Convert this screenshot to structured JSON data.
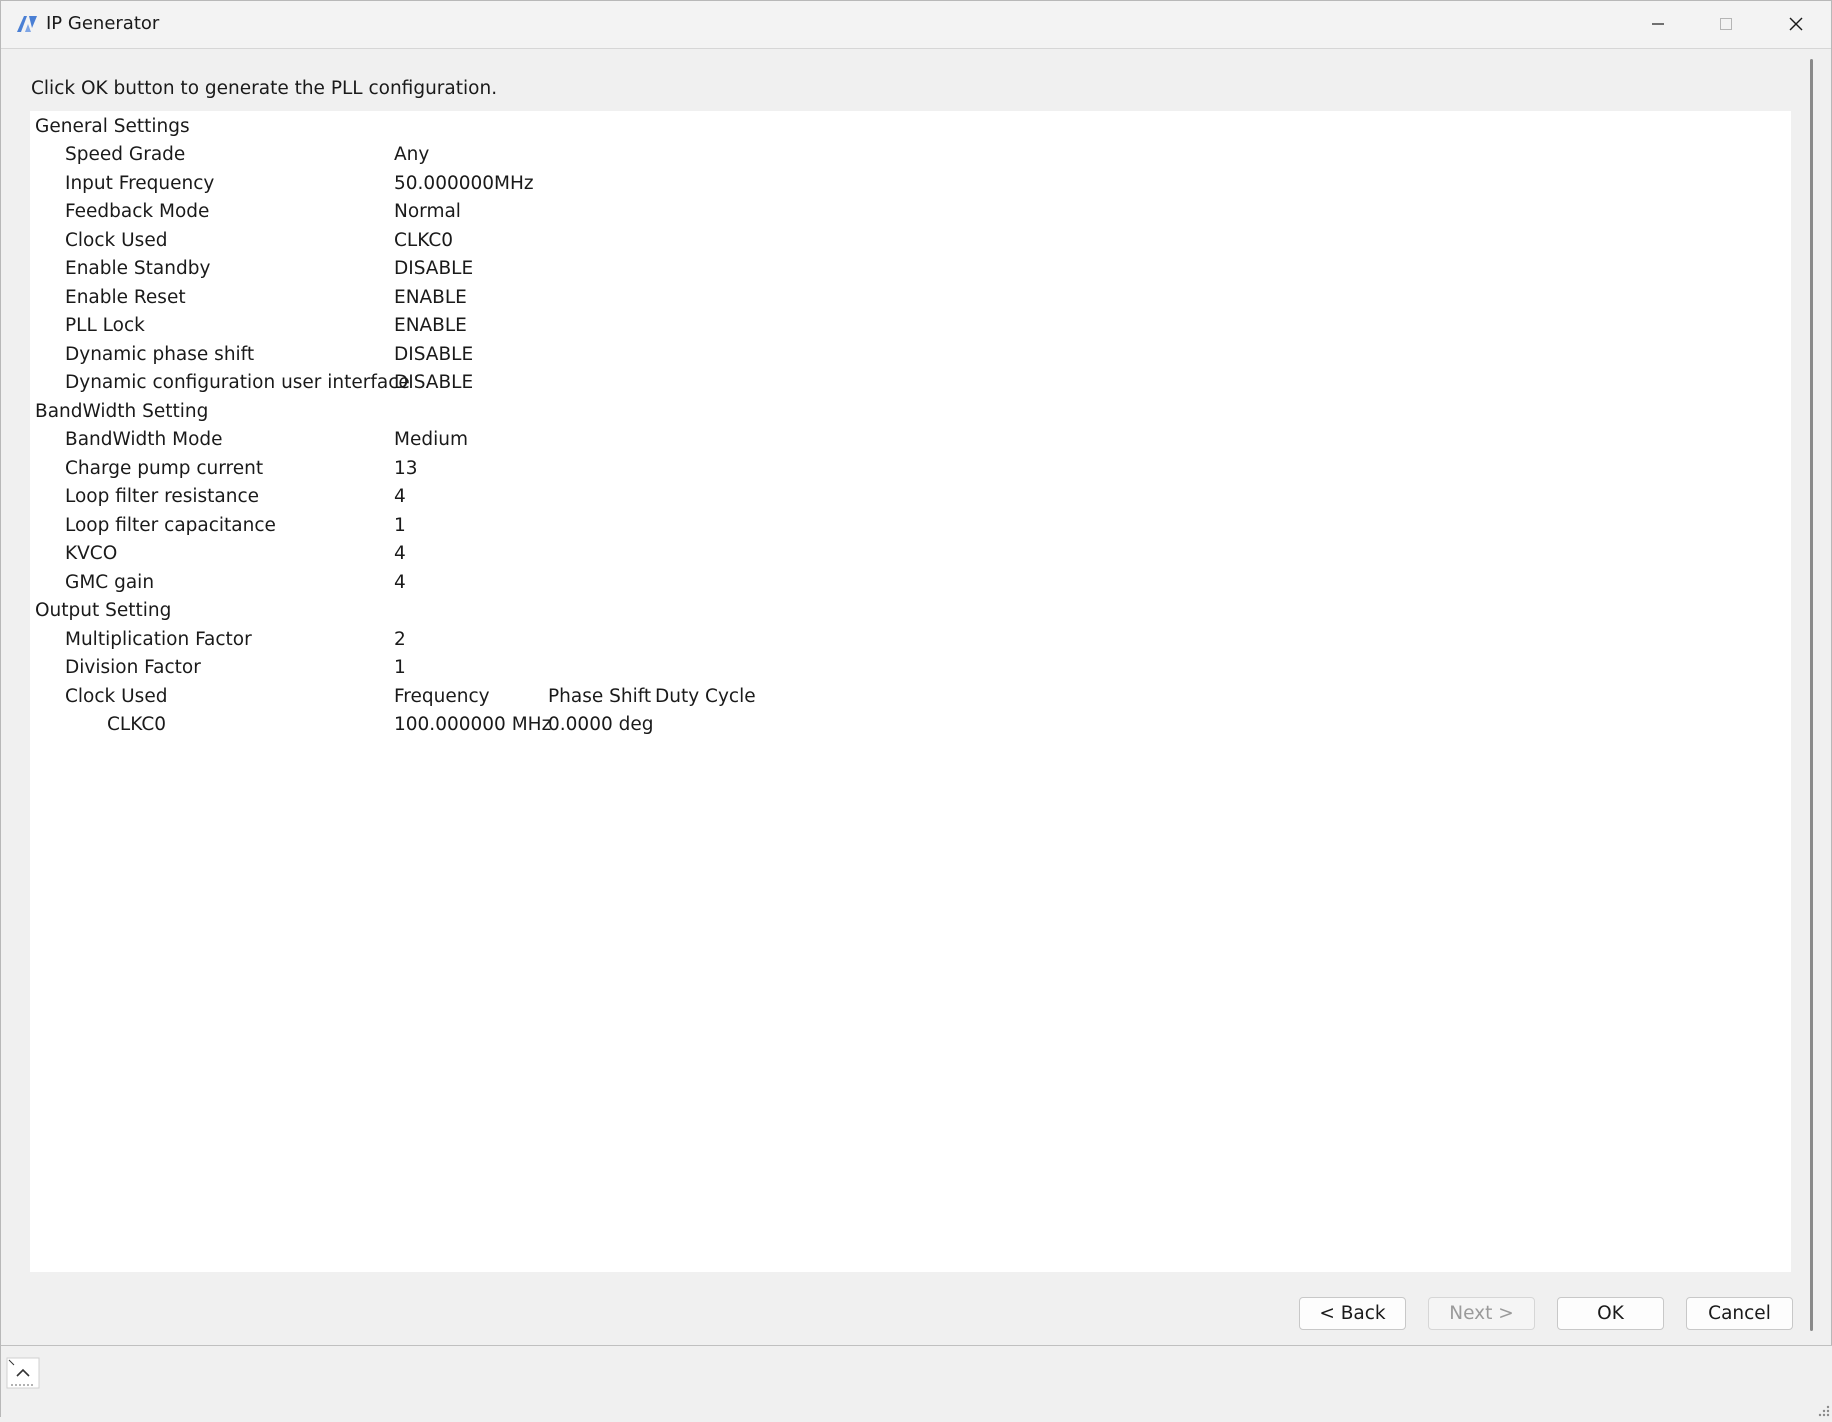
{
  "window": {
    "title": "IP Generator"
  },
  "instruction": "Click OK button to generate the PLL configuration.",
  "sections": {
    "general": {
      "label": "General Settings",
      "rows": [
        {
          "label": "Speed Grade",
          "value": "Any"
        },
        {
          "label": "Input Frequency",
          "value": "50.000000MHz"
        },
        {
          "label": "Feedback Mode",
          "value": "Normal"
        },
        {
          "label": "Clock Used",
          "value": "CLKC0"
        },
        {
          "label": "Enable Standby",
          "value": "DISABLE"
        },
        {
          "label": "Enable Reset",
          "value": "ENABLE"
        },
        {
          "label": "PLL Lock",
          "value": "ENABLE"
        },
        {
          "label": "Dynamic phase shift",
          "value": "DISABLE"
        },
        {
          "label": "Dynamic configuration user interface",
          "value": "DISABLE"
        }
      ]
    },
    "bandwidth": {
      "label": "BandWidth Setting",
      "rows": [
        {
          "label": "BandWidth Mode",
          "value": "Medium"
        },
        {
          "label": "Charge pump current",
          "value": "13"
        },
        {
          "label": "Loop filter resistance",
          "value": "4"
        },
        {
          "label": "Loop filter capacitance",
          "value": "1"
        },
        {
          "label": "KVCO",
          "value": "4"
        },
        {
          "label": "GMC gain",
          "value": "4"
        }
      ]
    },
    "output": {
      "label": "Output Setting",
      "rows": [
        {
          "label": "Multiplication Factor",
          "value": "2"
        },
        {
          "label": "Division Factor",
          "value": "1"
        }
      ],
      "clock_header": {
        "label": "Clock Used",
        "frequency": "Frequency",
        "phase_shift": "Phase Shift",
        "duty_cycle": "Duty Cycle"
      },
      "clocks": [
        {
          "name": "CLKC0",
          "frequency": "100.000000 MHz",
          "phase_shift": "0.0000 deg",
          "duty_cycle": ""
        }
      ]
    }
  },
  "buttons": {
    "back": "< Back",
    "next": "Next >",
    "ok": "OK",
    "cancel": "Cancel"
  },
  "icons": {
    "app": "app-logo-icon",
    "minimize": "minimize-icon",
    "maximize": "maximize-icon",
    "close": "close-icon",
    "status": "collapse-up-icon",
    "grip": "resize-grip-icon"
  },
  "colors": {
    "window_bg": "#f0f0f0",
    "panel_bg": "#ffffff",
    "disabled_text": "#9a9a9a",
    "logo_blue": "#4a7fd4"
  }
}
